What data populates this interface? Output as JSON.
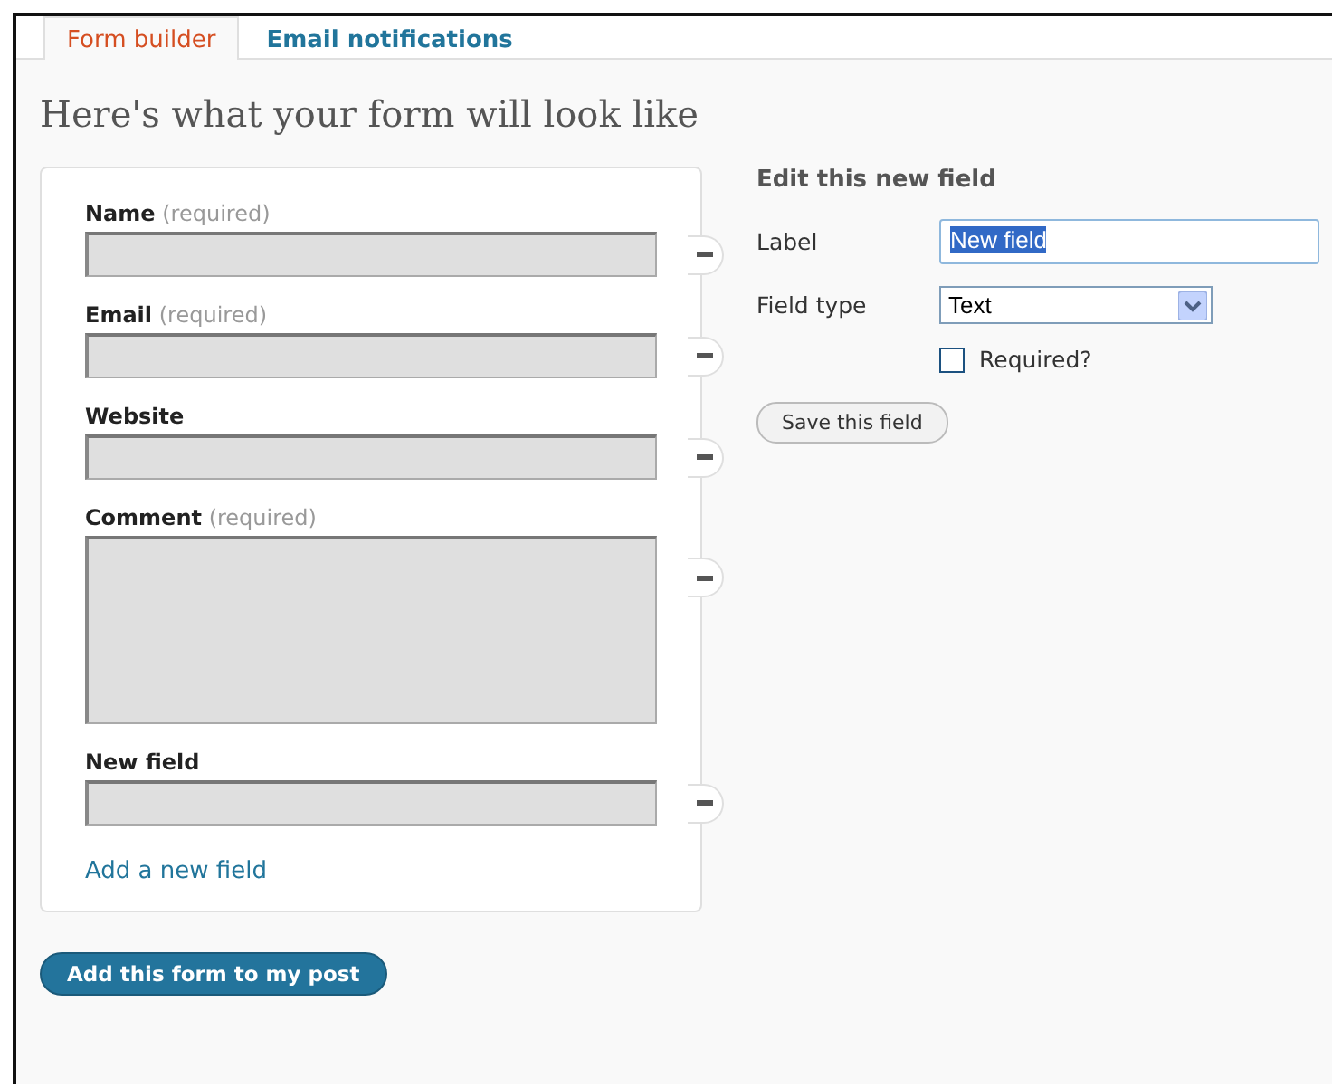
{
  "tabs": [
    {
      "label": "Form builder",
      "selected": true
    },
    {
      "label": "Email notifications",
      "selected": false
    }
  ],
  "heading": "Here's what your form will look like",
  "form_preview": {
    "fields": [
      {
        "kind": "text",
        "label": "Name",
        "note": "(required)"
      },
      {
        "kind": "text",
        "label": "Email",
        "note": "(required)"
      },
      {
        "kind": "text",
        "label": "Website"
      },
      {
        "kind": "textarea",
        "label": "Comment",
        "note": "(required)"
      },
      {
        "kind": "text",
        "label": "New field"
      }
    ],
    "add_link": "Add a new field"
  },
  "editor": {
    "title": "Edit this new field",
    "label_caption": "Label",
    "label_value": "New field",
    "label_value_selected": true,
    "type_caption": "Field type",
    "type_value": "Text",
    "required": {
      "label": "Required?",
      "checked": false
    },
    "save_button": "Save this field"
  },
  "submit_button": "Add this form to my post"
}
